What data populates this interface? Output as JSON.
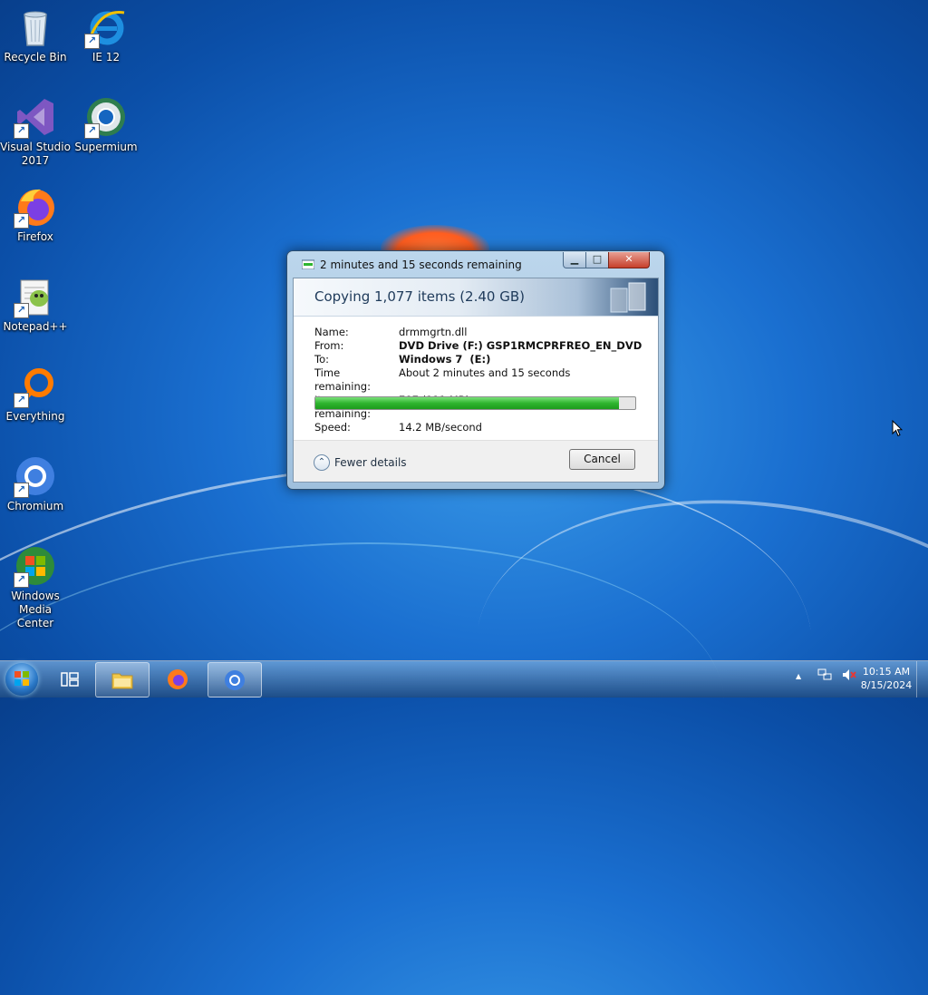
{
  "desktop": {
    "icons": [
      {
        "label": "Recycle Bin",
        "icon": "recycle-bin-icon"
      },
      {
        "label": "IE 12",
        "icon": "internet-explorer-icon"
      },
      {
        "label": "Visual Studio 2017",
        "icon": "visual-studio-icon"
      },
      {
        "label": "Supermium",
        "icon": "supermium-icon"
      },
      {
        "label": "Firefox",
        "icon": "firefox-icon"
      },
      {
        "label": "Notepad++",
        "icon": "notepadpp-icon"
      },
      {
        "label": "Everything",
        "icon": "everything-icon"
      },
      {
        "label": "Chromium",
        "icon": "chromium-icon"
      },
      {
        "label": "Windows Media Center",
        "icon": "windows-media-center-icon"
      }
    ]
  },
  "dialog": {
    "title": "2 minutes and 15 seconds remaining",
    "heading": "Copying 1,077 items (2.40 GB)",
    "details": {
      "name_label": "Name:",
      "name_value": "drmmgrtn.dll",
      "from_label": "From:",
      "from_value": "DVD Drive (F:) GSP1RMCPRFREO_EN_DVD",
      "to_label": "To:",
      "to_value": "Windows 7  (E:)",
      "time_label": "Time remaining:",
      "time_value": "About 2 minutes and 15 seconds",
      "items_label": "Items remaining:",
      "items_value": "787 (111 MB)",
      "speed_label": "Speed:",
      "speed_value": "14.2 MB/second"
    },
    "progress_fraction": 0.95,
    "fewer_details": "Fewer details",
    "cancel": "Cancel",
    "minimize_glyph": "▁",
    "maximize_glyph": "□",
    "close_glyph": "✕"
  },
  "taskbar": {
    "buttons": [
      "start-button",
      "task-view",
      "file-explorer",
      "firefox",
      "chromium"
    ],
    "tray_chevron": "▲",
    "time": "10:15 AM",
    "date": "8/15/2024"
  },
  "colors": {
    "progress_green": "#2fb52f",
    "close_red": "#c63f2b",
    "desktop_blue": "#1a6fd0"
  }
}
